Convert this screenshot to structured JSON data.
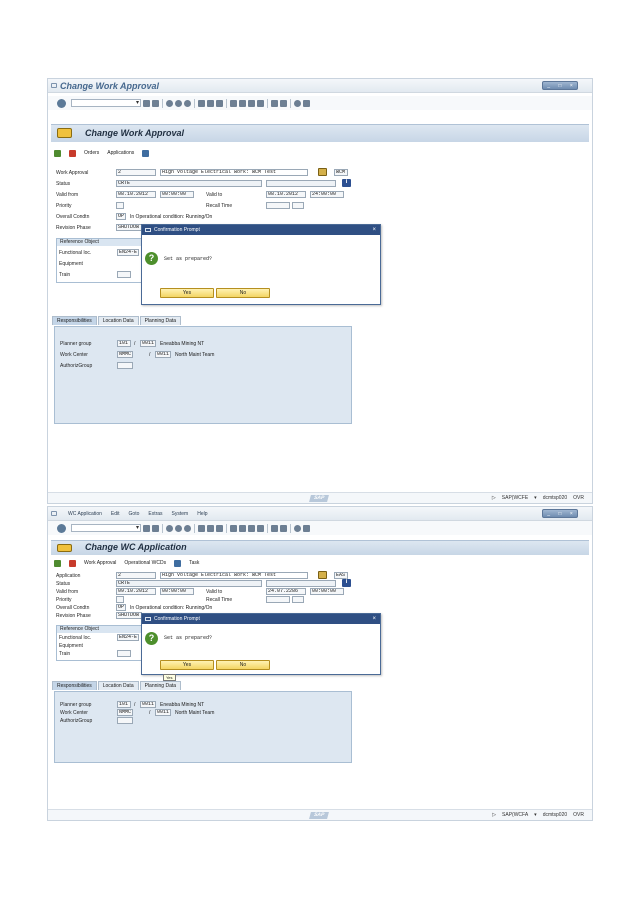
{
  "screen1": {
    "window_title": "Change Work Approval",
    "app_title": "Change Work Approval",
    "tools": {
      "orders": "Orders",
      "applications": "Applications"
    },
    "form": {
      "work_approval_label": "Work Approval",
      "work_approval_value": "2",
      "work_approval_desc": "High voltage Electrical work: WCM Test",
      "work_approval_code": "WCM",
      "status_label": "Status",
      "status_value": "CRTE",
      "valid_from_label": "Valid from",
      "valid_from_date": "08.10.2012",
      "valid_from_time": "00:00:00",
      "valid_to_label": "Valid to",
      "valid_to_date": "08.10.2012",
      "valid_to_time": "24:00:00",
      "priority_label": "Priority",
      "recall_time_label": "Recall Time",
      "overall_condtn_label": "Overall Condtn",
      "overall_condtn_code": "OP",
      "overall_condtn_text": "In Operational condition: Running/On",
      "revision_phase_label": "Revision Phase",
      "revision_phase_value": "SHUTDOW"
    },
    "reference": {
      "title": "Reference Object",
      "functional_loc_label": "Functional loc.",
      "functional_loc_value": "EN24-E",
      "equipment_label": "Equipment",
      "train_label": "Train"
    },
    "tabs": [
      "Responsibilities",
      "Location Data",
      "Planning Data"
    ],
    "resp": {
      "planner_group_label": "Planner group",
      "planner_group_a": "101",
      "planner_group_b": "0011",
      "planner_group_text": "Eneabba Mining NT",
      "slash": "/",
      "work_center_label": "Work Center",
      "work_center_a": "NMMC",
      "work_center_b": "0011",
      "work_center_text": "North Maint Team",
      "author_group_label": "AuthorizGroup"
    },
    "dialog": {
      "title": "Confirmation Prompt",
      "question": "Set as prepared?",
      "yes": "Yes",
      "no": "No"
    },
    "status": {
      "logo": "SAP",
      "system": "SAP(WCFE",
      "server": "dcmtsp020",
      "mode": "OVR"
    }
  },
  "screen2": {
    "menu": [
      "WC Application",
      "Edit",
      "Goto",
      "Extras",
      "System",
      "Help"
    ],
    "app_title": "Change WC Application",
    "tools": {
      "work_approval": "Work Approval",
      "operational_wcds": "Operational WCDs",
      "task": "Task"
    },
    "form": {
      "application_label": "Application",
      "application_value": "2",
      "application_desc": "High voltage Electrical work: WCM Test",
      "application_code": "EAS",
      "status_label": "Status",
      "status_value": "CRTE",
      "valid_from_label": "Valid from",
      "valid_from_date": "09.10.2012",
      "valid_from_time": "00:00:00",
      "valid_to_label": "Valid to",
      "valid_to_date": "24.07.2286",
      "valid_to_time": "00:00:00",
      "priority_label": "Priority",
      "recall_time_label": "Recall Time",
      "overall_condtn_label": "Overall Condtn",
      "overall_condtn_code": "OP",
      "overall_condtn_text": "In Operational condition: Running/On",
      "revision_phase_label": "Revision Phase",
      "revision_phase_value": "SHUTDOW"
    },
    "reference": {
      "title": "Reference Object",
      "functional_loc_label": "Functional loc.",
      "functional_loc_value": "EN24-E",
      "equipment_label": "Equipment",
      "train_label": "Train"
    },
    "tabs": [
      "Responsibilities",
      "Location Data",
      "Planning Data"
    ],
    "resp": {
      "planner_group_label": "Planner group",
      "planner_group_a": "101",
      "planner_group_b": "0011",
      "planner_group_text": "Eneabba Mining NT",
      "slash": "/",
      "work_center_label": "Work Center",
      "work_center_a": "NMMC",
      "work_center_b": "0011",
      "work_center_text": "North Maint Team",
      "author_group_label": "AuthorizGroup"
    },
    "dialog": {
      "title": "Confirmation Prompt",
      "question": "Set as prepared?",
      "yes": "Yes",
      "no": "No",
      "tooltip": "Yes"
    },
    "status": {
      "logo": "SAP",
      "system": "SAP(WCFA",
      "server": "dcmtsp020",
      "mode": "OVR"
    }
  },
  "colors": {
    "sap_blue": "#2f4f83",
    "band": "#dde7f1",
    "button_yellow": "#f3d563",
    "ok_green": "#4d8f2c"
  }
}
